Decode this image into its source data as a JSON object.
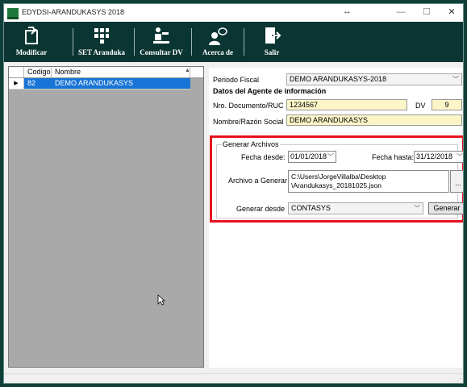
{
  "window": {
    "title": "EDYDSI-ARANDUKASYS 2018"
  },
  "toolbar": {
    "modificar": "Modificar",
    "set_aranduka": "SET Aranduka",
    "consultar_dv": "Consultar DV",
    "acerca_de": "Acerca de",
    "salir": "Salir"
  },
  "grid": {
    "columns": [
      "Codigo",
      "Nombre"
    ],
    "rows": [
      {
        "codigo": "82",
        "nombre": "DEMO ARANDUKASYS"
      }
    ]
  },
  "form": {
    "periodo_label": "Periodo Fiscal",
    "periodo_value": "DEMO ARANDUKASYS-2018",
    "section_title": "Datos del Agente de información",
    "ruc_label": "Nro. Documento/RUC",
    "ruc_value": "1234567",
    "dv_label": "DV",
    "dv_value": "9",
    "nombre_label": "Nombre/Razón Social",
    "nombre_value": "DEMO ARANDUKASYS"
  },
  "generar": {
    "group_title": "Generar Archivos",
    "fecha_desde_label": "Fecha desde:",
    "fecha_desde_value": "01/01/2018",
    "fecha_hasta_label": "Fecha hasta:",
    "fecha_hasta_value": "31/12/2018",
    "archivo_label": "Archivo a Generar",
    "archivo_line1": "C:\\Users\\JorgeVillalba\\Desktop",
    "archivo_line2": "\\Arandukasys_20181025.json",
    "browse_label": "...",
    "generar_desde_label": "Generar desde",
    "generar_desde_value": "CONTASYS",
    "generar_button": "Generar"
  },
  "colors": {
    "toolbar_bg": "#0a3532",
    "selection": "#1874d6",
    "highlight": "#e3141e",
    "input_bg": "#fbf5c8"
  }
}
